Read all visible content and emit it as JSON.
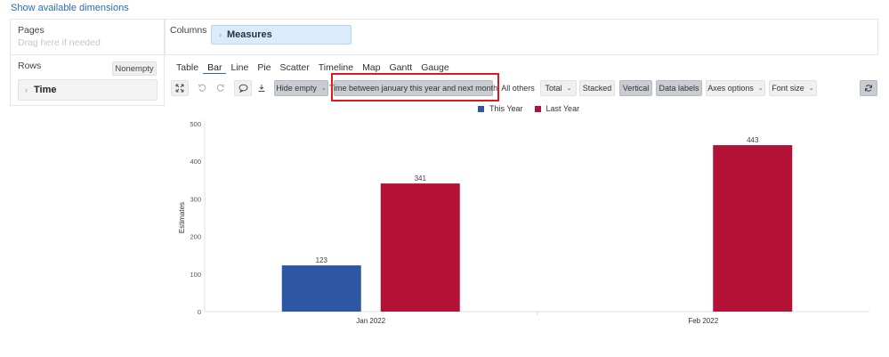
{
  "top_link": "Show available dimensions",
  "pages": {
    "title": "Pages",
    "hint": "Drag here if needed"
  },
  "columns": {
    "title": "Columns",
    "chip": "Measures"
  },
  "rows": {
    "title": "Rows",
    "nonempty_label": "Nonempty",
    "item": "Time"
  },
  "view_tabs": [
    {
      "label": "Table",
      "active": false
    },
    {
      "label": "Bar",
      "active": true
    },
    {
      "label": "Line",
      "active": false
    },
    {
      "label": "Pie",
      "active": false
    },
    {
      "label": "Scatter",
      "active": false
    },
    {
      "label": "Timeline",
      "active": false
    },
    {
      "label": "Map",
      "active": false
    },
    {
      "label": "Gantt",
      "active": false
    },
    {
      "label": "Gauge",
      "active": false
    }
  ],
  "toolbar": {
    "hide_empty": "Hide empty",
    "time_filter": "Time between january this year and next month",
    "all_others": "All others",
    "total": "Total",
    "stacked": "Stacked",
    "vertical": "Vertical",
    "data_labels": "Data labels",
    "axes_options": "Axes options",
    "font_size": "Font size",
    "icons": [
      "expand-icon",
      "undo-icon",
      "redo-icon",
      "comment-icon",
      "download-icon",
      "refresh-icon"
    ]
  },
  "colors": {
    "this_year": "#2d57a2",
    "last_year": "#b31236",
    "highlight": "#e01a1a",
    "accent": "#2a6cb4"
  },
  "chart_data": {
    "type": "bar",
    "categories": [
      "Jan 2022",
      "Feb 2022"
    ],
    "series": [
      {
        "name": "This Year",
        "values": [
          123,
          null
        ],
        "color": "#2d57a2"
      },
      {
        "name": "Last Year",
        "values": [
          341,
          443
        ],
        "color": "#b31236"
      }
    ],
    "ylabel": "Estimates",
    "xlabel": "",
    "ylim": [
      0,
      500
    ],
    "yticks": [
      0,
      100,
      200,
      300,
      400,
      500
    ],
    "data_labels": true,
    "legend": "top-center",
    "grid": false
  }
}
